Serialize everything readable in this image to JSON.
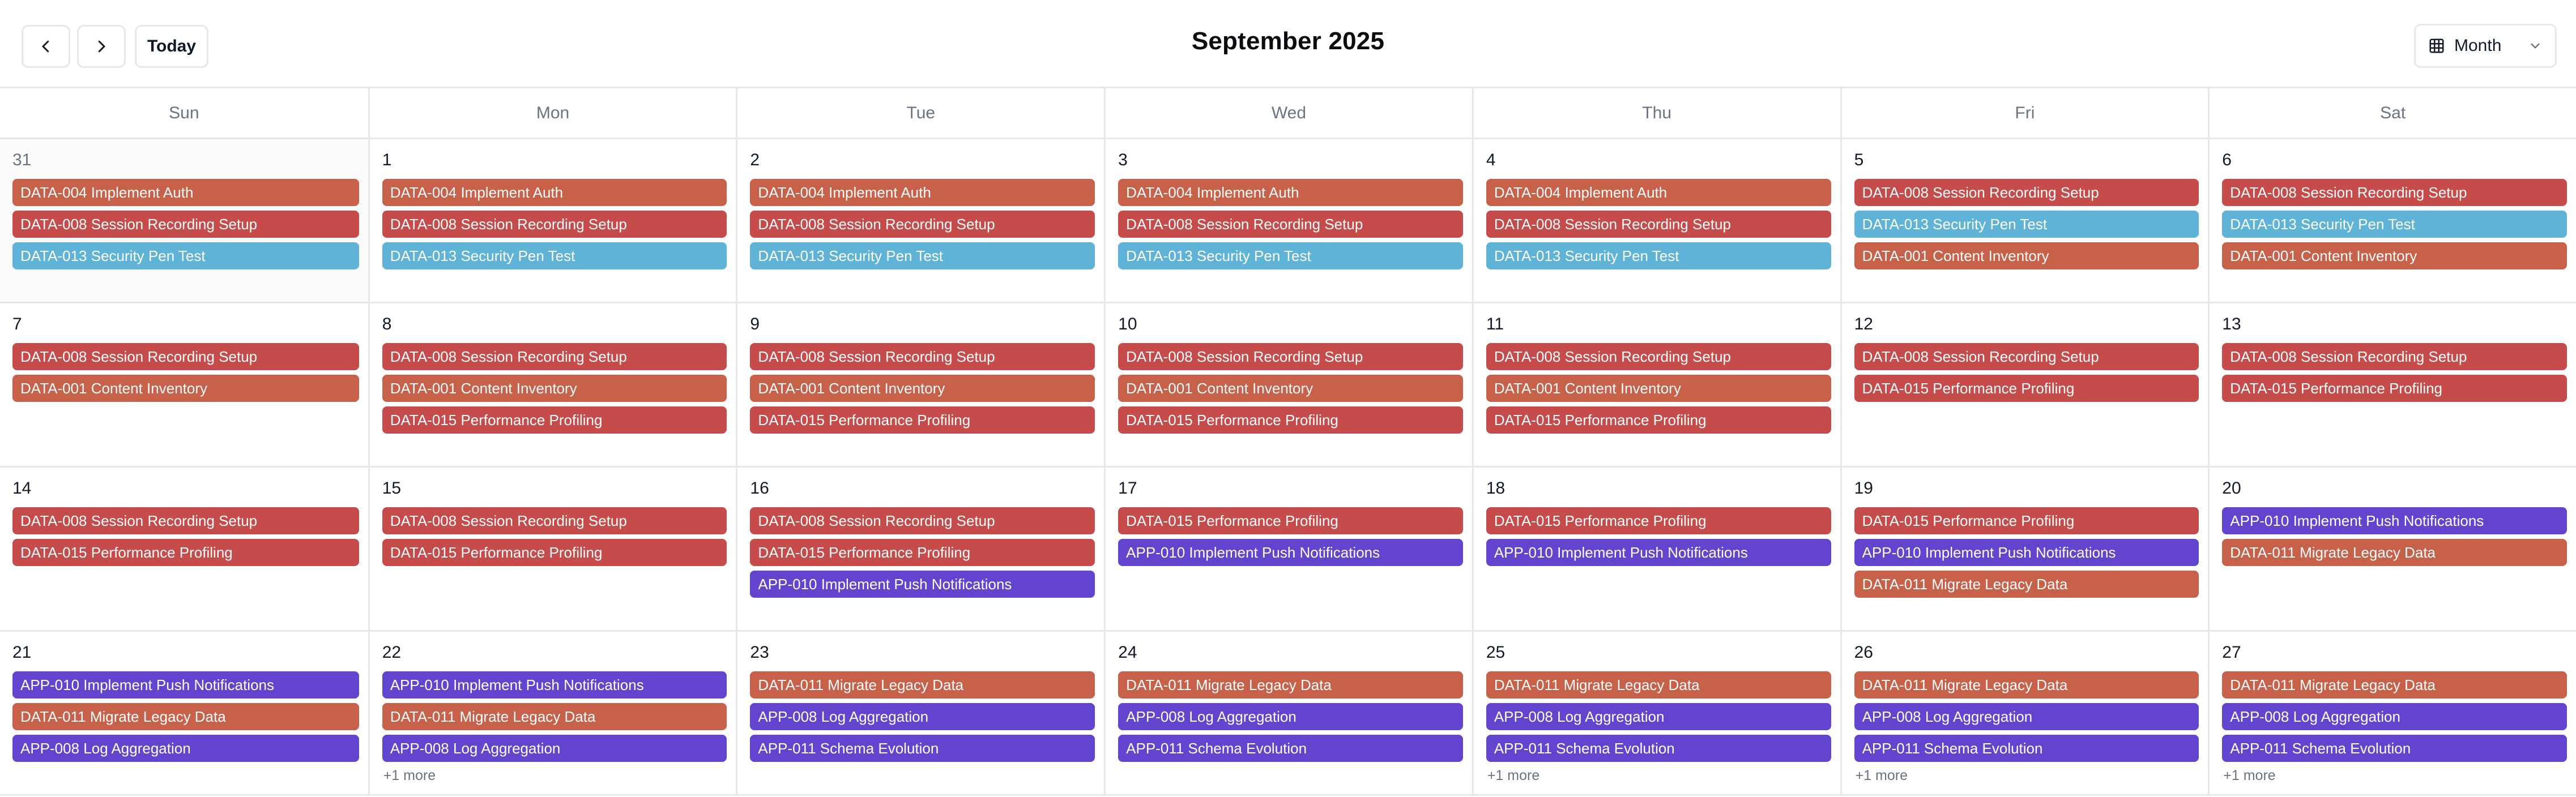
{
  "toolbar": {
    "today_label": "Today",
    "title": "September 2025",
    "view_label": "Month"
  },
  "colors": {
    "orange": "#c8614a",
    "red": "#c64c4b",
    "blue": "#5fb3d6",
    "purple": "#6244cf"
  },
  "weekdays": [
    "Sun",
    "Mon",
    "Tue",
    "Wed",
    "Thu",
    "Fri",
    "Sat"
  ],
  "weeks": [
    [
      {
        "day": "31",
        "outside": true,
        "events": [
          {
            "label": "DATA-004 Implement Auth",
            "color": "orange"
          },
          {
            "label": "DATA-008 Session Recording Setup",
            "color": "red"
          },
          {
            "label": "DATA-013 Security Pen Test",
            "color": "blue"
          }
        ]
      },
      {
        "day": "1",
        "events": [
          {
            "label": "DATA-004 Implement Auth",
            "color": "orange"
          },
          {
            "label": "DATA-008 Session Recording Setup",
            "color": "red"
          },
          {
            "label": "DATA-013 Security Pen Test",
            "color": "blue"
          }
        ]
      },
      {
        "day": "2",
        "events": [
          {
            "label": "DATA-004 Implement Auth",
            "color": "orange"
          },
          {
            "label": "DATA-008 Session Recording Setup",
            "color": "red"
          },
          {
            "label": "DATA-013 Security Pen Test",
            "color": "blue"
          }
        ]
      },
      {
        "day": "3",
        "events": [
          {
            "label": "DATA-004 Implement Auth",
            "color": "orange"
          },
          {
            "label": "DATA-008 Session Recording Setup",
            "color": "red"
          },
          {
            "label": "DATA-013 Security Pen Test",
            "color": "blue"
          }
        ]
      },
      {
        "day": "4",
        "events": [
          {
            "label": "DATA-004 Implement Auth",
            "color": "orange"
          },
          {
            "label": "DATA-008 Session Recording Setup",
            "color": "red"
          },
          {
            "label": "DATA-013 Security Pen Test",
            "color": "blue"
          }
        ]
      },
      {
        "day": "5",
        "events": [
          {
            "label": "DATA-008 Session Recording Setup",
            "color": "red"
          },
          {
            "label": "DATA-013 Security Pen Test",
            "color": "blue"
          },
          {
            "label": "DATA-001 Content Inventory",
            "color": "orange"
          }
        ]
      },
      {
        "day": "6",
        "events": [
          {
            "label": "DATA-008 Session Recording Setup",
            "color": "red"
          },
          {
            "label": "DATA-013 Security Pen Test",
            "color": "blue"
          },
          {
            "label": "DATA-001 Content Inventory",
            "color": "orange"
          }
        ]
      }
    ],
    [
      {
        "day": "7",
        "events": [
          {
            "label": "DATA-008 Session Recording Setup",
            "color": "red"
          },
          {
            "label": "DATA-001 Content Inventory",
            "color": "orange"
          }
        ]
      },
      {
        "day": "8",
        "events": [
          {
            "label": "DATA-008 Session Recording Setup",
            "color": "red"
          },
          {
            "label": "DATA-001 Content Inventory",
            "color": "orange"
          },
          {
            "label": "DATA-015 Performance Profiling",
            "color": "red"
          }
        ]
      },
      {
        "day": "9",
        "events": [
          {
            "label": "DATA-008 Session Recording Setup",
            "color": "red"
          },
          {
            "label": "DATA-001 Content Inventory",
            "color": "orange"
          },
          {
            "label": "DATA-015 Performance Profiling",
            "color": "red"
          }
        ]
      },
      {
        "day": "10",
        "events": [
          {
            "label": "DATA-008 Session Recording Setup",
            "color": "red"
          },
          {
            "label": "DATA-001 Content Inventory",
            "color": "orange"
          },
          {
            "label": "DATA-015 Performance Profiling",
            "color": "red"
          }
        ]
      },
      {
        "day": "11",
        "events": [
          {
            "label": "DATA-008 Session Recording Setup",
            "color": "red"
          },
          {
            "label": "DATA-001 Content Inventory",
            "color": "orange"
          },
          {
            "label": "DATA-015 Performance Profiling",
            "color": "red"
          }
        ]
      },
      {
        "day": "12",
        "events": [
          {
            "label": "DATA-008 Session Recording Setup",
            "color": "red"
          },
          {
            "label": "DATA-015 Performance Profiling",
            "color": "red"
          }
        ]
      },
      {
        "day": "13",
        "events": [
          {
            "label": "DATA-008 Session Recording Setup",
            "color": "red"
          },
          {
            "label": "DATA-015 Performance Profiling",
            "color": "red"
          }
        ]
      }
    ],
    [
      {
        "day": "14",
        "events": [
          {
            "label": "DATA-008 Session Recording Setup",
            "color": "red"
          },
          {
            "label": "DATA-015 Performance Profiling",
            "color": "red"
          }
        ]
      },
      {
        "day": "15",
        "events": [
          {
            "label": "DATA-008 Session Recording Setup",
            "color": "red"
          },
          {
            "label": "DATA-015 Performance Profiling",
            "color": "red"
          }
        ]
      },
      {
        "day": "16",
        "events": [
          {
            "label": "DATA-008 Session Recording Setup",
            "color": "red"
          },
          {
            "label": "DATA-015 Performance Profiling",
            "color": "red"
          },
          {
            "label": "APP-010 Implement Push Notifications",
            "color": "purple"
          }
        ]
      },
      {
        "day": "17",
        "events": [
          {
            "label": "DATA-015 Performance Profiling",
            "color": "red"
          },
          {
            "label": "APP-010 Implement Push Notifications",
            "color": "purple"
          }
        ]
      },
      {
        "day": "18",
        "events": [
          {
            "label": "DATA-015 Performance Profiling",
            "color": "red"
          },
          {
            "label": "APP-010 Implement Push Notifications",
            "color": "purple"
          }
        ]
      },
      {
        "day": "19",
        "events": [
          {
            "label": "DATA-015 Performance Profiling",
            "color": "red"
          },
          {
            "label": "APP-010 Implement Push Notifications",
            "color": "purple"
          },
          {
            "label": "DATA-011 Migrate Legacy Data",
            "color": "orange"
          }
        ]
      },
      {
        "day": "20",
        "events": [
          {
            "label": "APP-010 Implement Push Notifications",
            "color": "purple"
          },
          {
            "label": "DATA-011 Migrate Legacy Data",
            "color": "orange"
          }
        ]
      }
    ],
    [
      {
        "day": "21",
        "events": [
          {
            "label": "APP-010 Implement Push Notifications",
            "color": "purple"
          },
          {
            "label": "DATA-011 Migrate Legacy Data",
            "color": "orange"
          },
          {
            "label": "APP-008 Log Aggregation",
            "color": "purple"
          }
        ]
      },
      {
        "day": "22",
        "more": "+1 more",
        "events": [
          {
            "label": "APP-010 Implement Push Notifications",
            "color": "purple"
          },
          {
            "label": "DATA-011 Migrate Legacy Data",
            "color": "orange"
          },
          {
            "label": "APP-008 Log Aggregation",
            "color": "purple"
          }
        ]
      },
      {
        "day": "23",
        "events": [
          {
            "label": "DATA-011 Migrate Legacy Data",
            "color": "orange"
          },
          {
            "label": "APP-008 Log Aggregation",
            "color": "purple"
          },
          {
            "label": "APP-011 Schema Evolution",
            "color": "purple"
          }
        ]
      },
      {
        "day": "24",
        "events": [
          {
            "label": "DATA-011 Migrate Legacy Data",
            "color": "orange"
          },
          {
            "label": "APP-008 Log Aggregation",
            "color": "purple"
          },
          {
            "label": "APP-011 Schema Evolution",
            "color": "purple"
          }
        ]
      },
      {
        "day": "25",
        "more": "+1 more",
        "events": [
          {
            "label": "DATA-011 Migrate Legacy Data",
            "color": "orange"
          },
          {
            "label": "APP-008 Log Aggregation",
            "color": "purple"
          },
          {
            "label": "APP-011 Schema Evolution",
            "color": "purple"
          }
        ]
      },
      {
        "day": "26",
        "more": "+1 more",
        "events": [
          {
            "label": "DATA-011 Migrate Legacy Data",
            "color": "orange"
          },
          {
            "label": "APP-008 Log Aggregation",
            "color": "purple"
          },
          {
            "label": "APP-011 Schema Evolution",
            "color": "purple"
          }
        ]
      },
      {
        "day": "27",
        "more": "+1 more",
        "events": [
          {
            "label": "DATA-011 Migrate Legacy Data",
            "color": "orange"
          },
          {
            "label": "APP-008 Log Aggregation",
            "color": "purple"
          },
          {
            "label": "APP-011 Schema Evolution",
            "color": "purple"
          }
        ]
      }
    ]
  ]
}
